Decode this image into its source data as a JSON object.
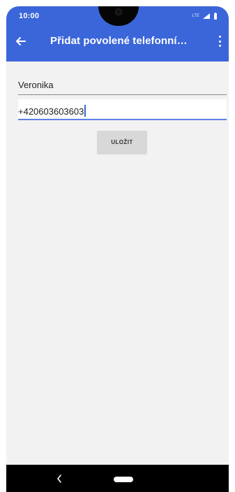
{
  "status_bar": {
    "time": "10:00",
    "network": "LTE"
  },
  "app_bar": {
    "title": "Přidat povolené telefonní…",
    "back_icon": "arrow-left-icon",
    "menu_icon": "more-vert-icon",
    "color": "#3b66d9"
  },
  "form": {
    "name_value": "Veronika",
    "phone_value": "+420603603603",
    "save_label": "ULOŽIT"
  },
  "navigation": {
    "back_icon": "chevron-left-icon",
    "home_icon": "home-pill-icon"
  }
}
